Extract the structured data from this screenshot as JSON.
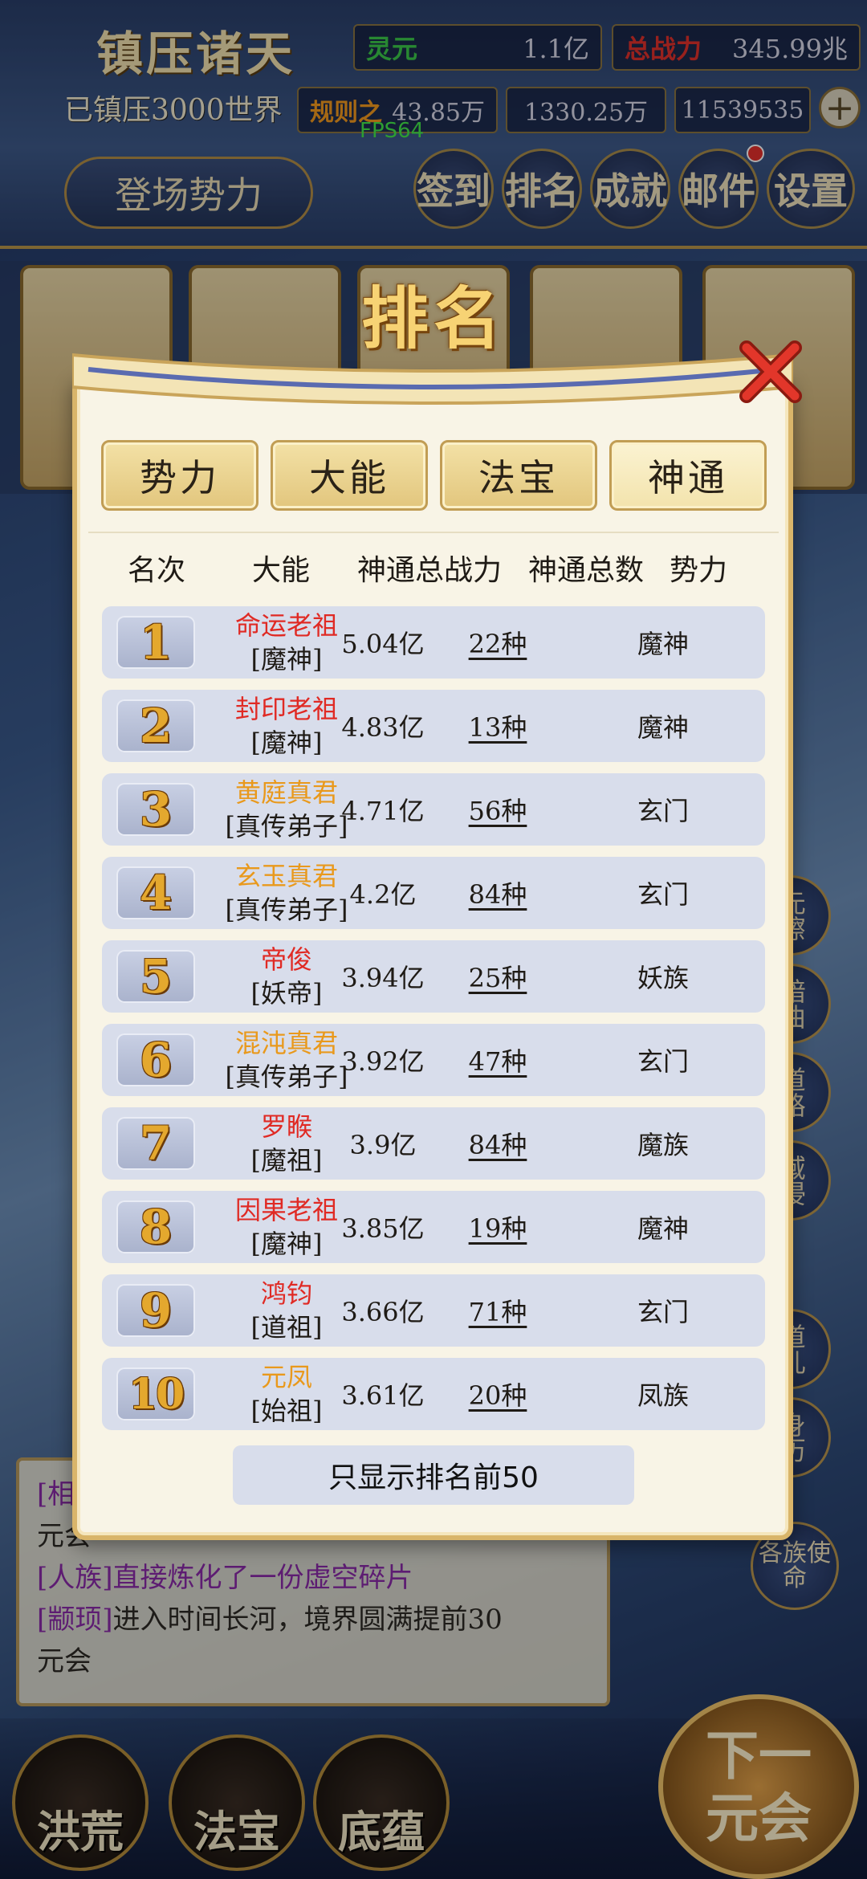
{
  "header": {
    "game_title": "镇压诸天",
    "world_text": "已镇压3000世界",
    "fps": "FPS64",
    "resources": [
      {
        "label": "灵元",
        "value": "1.1亿"
      },
      {
        "label": "总战力",
        "value": "345.99兆"
      },
      {
        "label": "规则之",
        "value": "43.85万"
      },
      {
        "label": "",
        "value": "1330.25万"
      },
      {
        "label": "",
        "value": "11539535"
      }
    ],
    "enter_button": "登场势力",
    "menu": [
      "签到",
      "排名",
      "成就",
      "邮件",
      "设置"
    ]
  },
  "modal": {
    "title": "排名",
    "tabs": [
      "势力",
      "大能",
      "法宝",
      "神通"
    ],
    "active_tab": "神通",
    "columns": [
      "名次",
      "大能",
      "神通总战力",
      "神通总数",
      "势力"
    ],
    "rows": [
      {
        "rank": "1",
        "name": "命运老祖",
        "name_color": "#e02a24",
        "title": "[魔神]",
        "power": "5.04亿",
        "count": "22种",
        "faction": "魔神"
      },
      {
        "rank": "2",
        "name": "封印老祖",
        "name_color": "#e02a24",
        "title": "[魔神]",
        "power": "4.83亿",
        "count": "13种",
        "faction": "魔神"
      },
      {
        "rank": "3",
        "name": "黄庭真君",
        "name_color": "#e9991c",
        "title": "[真传弟子]",
        "power": "4.71亿",
        "count": "56种",
        "faction": "玄门"
      },
      {
        "rank": "4",
        "name": "玄玉真君",
        "name_color": "#e9991c",
        "title": "[真传弟子]",
        "power": "4.2亿",
        "count": "84种",
        "faction": "玄门"
      },
      {
        "rank": "5",
        "name": "帝俊",
        "name_color": "#e02a24",
        "title": "[妖帝]",
        "power": "3.94亿",
        "count": "25种",
        "faction": "妖族"
      },
      {
        "rank": "6",
        "name": "混沌真君",
        "name_color": "#e9991c",
        "title": "[真传弟子]",
        "power": "3.92亿",
        "count": "47种",
        "faction": "玄门"
      },
      {
        "rank": "7",
        "name": "罗睺",
        "name_color": "#e02a24",
        "title": "[魔祖]",
        "power": "3.9亿",
        "count": "84种",
        "faction": "魔族"
      },
      {
        "rank": "8",
        "name": "因果老祖",
        "name_color": "#e02a24",
        "title": "[魔神]",
        "power": "3.85亿",
        "count": "19种",
        "faction": "魔神"
      },
      {
        "rank": "9",
        "name": "鸿钧",
        "name_color": "#e02a24",
        "title": "[道祖]",
        "power": "3.66亿",
        "count": "71种",
        "faction": "玄门"
      },
      {
        "rank": "10",
        "name": "元凤",
        "name_color": "#e9991c",
        "title": "[始祖]",
        "power": "3.61亿",
        "count": "20种",
        "faction": "凤族"
      }
    ],
    "footer_note": "只显示排名前50"
  },
  "log": {
    "lines": [
      {
        "tag": "[相",
        "text": "",
        "rest": "元会"
      },
      {
        "tag": "[人族]",
        "text": "直接炼化了一份虚空碎片",
        "rest": ""
      },
      {
        "tag": "[颛顼]",
        "text": "进入时间长河，境界圆满提前30",
        "rest": "元会"
      }
    ]
  },
  "side_buttons": [
    "元擦",
    "諳曲",
    "道路",
    "域侵",
    "道儿",
    "身历",
    "各族使命"
  ],
  "bottom_nav": [
    "洪荒",
    "法宝",
    "底蕴"
  ],
  "next_button": "下一元会"
}
